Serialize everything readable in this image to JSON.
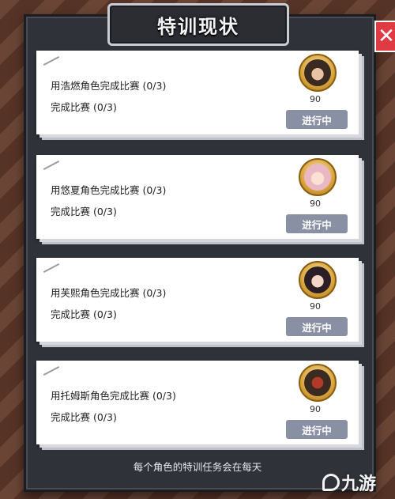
{
  "title": "特训现状",
  "close_label": "✕",
  "tasks": [
    {
      "task1": "用浩燃角色完成比赛 (0/3)",
      "task2": "完成比赛 (0/3)",
      "points": "90",
      "status": "进行中",
      "avatar_color": "#3a2a22"
    },
    {
      "task1": "用悠夏角色完成比赛 (0/3)",
      "task2": "完成比赛 (0/3)",
      "points": "90",
      "status": "进行中",
      "avatar_color": "#e9b8c4"
    },
    {
      "task1": "用芙熙角色完成比赛 (0/3)",
      "task2": "完成比赛 (0/3)",
      "points": "90",
      "status": "进行中",
      "avatar_color": "#2b1e24"
    },
    {
      "task1": "用托姆斯角色完成比赛 (0/3)",
      "task2": "完成比赛 (0/3)",
      "points": "90",
      "status": "进行中",
      "avatar_color": "#b23a2a"
    }
  ],
  "footer_note": "每个角色的特训任务会在每天",
  "watermark": "九游",
  "colors": {
    "status_button": "#8a90a4",
    "close_button": "#e03a43",
    "panel": "#2f3238"
  }
}
